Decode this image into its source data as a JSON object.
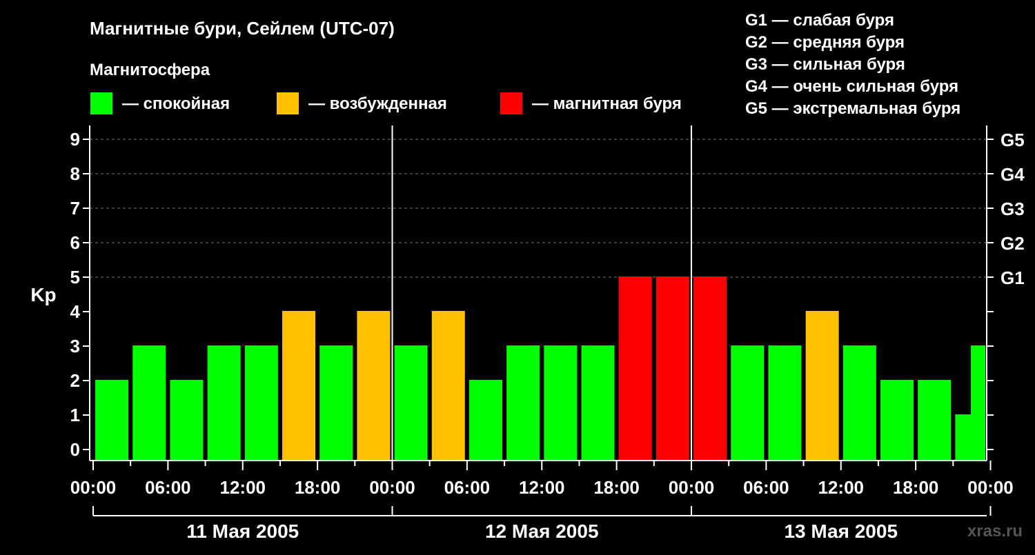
{
  "title": "Магнитные бури, Сейлем (UTC-07)",
  "legend": {
    "heading": "Магнитосфера",
    "items": [
      {
        "label": "— спокойная",
        "color": "#00ff00"
      },
      {
        "label": "— возбужденная",
        "color": "#ffc000"
      },
      {
        "label": "— магнитная буря",
        "color": "#ff0000"
      }
    ]
  },
  "g_scale": [
    "G1 — слабая буря",
    "G2 — средняя буря",
    "G3 — сильная буря",
    "G4 — очень сильная буря",
    "G5 — экстремальная буря"
  ],
  "watermark": "xras.ru",
  "chart_data": {
    "type": "bar",
    "ylabel": "Kp",
    "ylim": [
      0,
      9
    ],
    "y_ticks": [
      "0",
      "1",
      "2",
      "3",
      "4",
      "5",
      "6",
      "7",
      "8",
      "9"
    ],
    "right_ticks": [
      {
        "y": 5,
        "label": "G1"
      },
      {
        "y": 6,
        "label": "G2"
      },
      {
        "y": 7,
        "label": "G3"
      },
      {
        "y": 8,
        "label": "G4"
      },
      {
        "y": 9,
        "label": "G5"
      }
    ],
    "x_tick_labels": [
      "00:00",
      "06:00",
      "12:00",
      "18:00",
      "00:00",
      "06:00",
      "12:00",
      "18:00",
      "00:00",
      "06:00",
      "12:00",
      "18:00",
      "00:00"
    ],
    "days": [
      "11 Мая 2005",
      "12 Мая 2005",
      "13 Мая 2005"
    ],
    "grid": true,
    "bar_hours": [
      1.5,
      4.5,
      7.5,
      10.5,
      13.5,
      16.5,
      19.5,
      22.5,
      25.5,
      28.5,
      31.5,
      34.5,
      37.5,
      40.5,
      43.5,
      46.5,
      49.5,
      52.5,
      55.5,
      58.5,
      61.5,
      64.5,
      67.5,
      70.5,
      71.75
    ],
    "values": [
      2,
      3,
      2,
      3,
      3,
      4,
      3,
      4,
      3,
      4,
      2,
      3,
      3,
      3,
      5,
      5,
      5,
      3,
      3,
      4,
      3,
      2,
      2,
      1,
      3
    ],
    "status": [
      "quiet",
      "quiet",
      "quiet",
      "quiet",
      "quiet",
      "active",
      "quiet",
      "active",
      "quiet",
      "active",
      "quiet",
      "quiet",
      "quiet",
      "quiet",
      "storm",
      "storm",
      "storm",
      "quiet",
      "quiet",
      "active",
      "quiet",
      "quiet",
      "quiet",
      "quiet",
      "quiet"
    ],
    "colors": {
      "quiet": "#00ff00",
      "active": "#ffc000",
      "storm": "#ff0000"
    }
  }
}
